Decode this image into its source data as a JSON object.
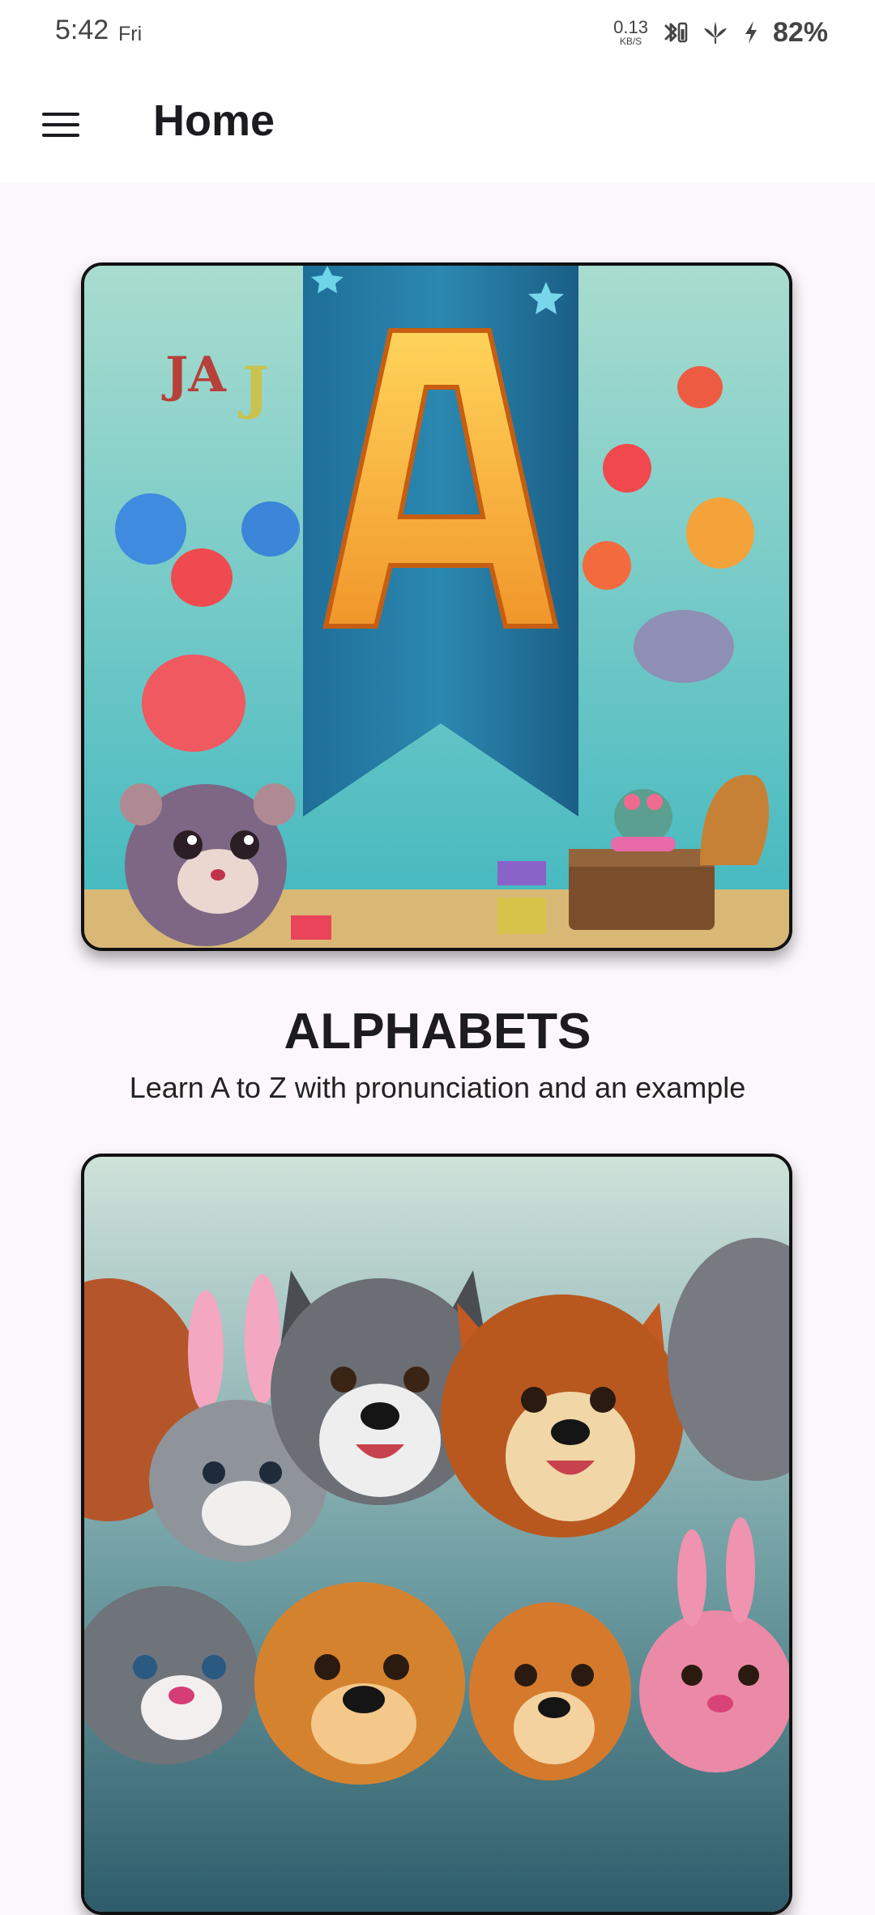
{
  "status_bar": {
    "time": "5:42",
    "day": "Fri",
    "net_speed": "0.13",
    "net_unit": "KB/S",
    "battery": "82%"
  },
  "app_bar": {
    "title": "Home",
    "menu_icon": "hamburger-menu-icon"
  },
  "cards": [
    {
      "title": "ALPHABETS",
      "description": "Learn A to Z with pronunciation and an example",
      "image": "alphabet-letter-a-illustration"
    },
    {
      "title": "",
      "description": "",
      "image": "cartoon-animals-illustration"
    }
  ],
  "colors": {
    "background": "#fcf7fb",
    "appbar": "#ffffff",
    "text": "#1c1b1f"
  }
}
